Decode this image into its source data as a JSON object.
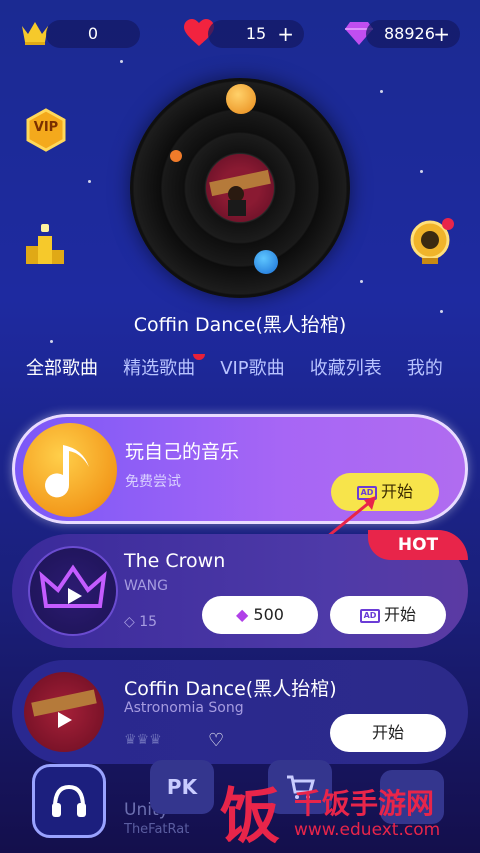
{
  "currency": {
    "crowns": "0",
    "hearts": "15",
    "diamonds": "88926",
    "plus": "+"
  },
  "vip_badge": "VIP",
  "now_playing": {
    "title": "Coffin Dance(黑人抬棺)"
  },
  "tabs": [
    {
      "label": "全部歌曲",
      "active": true
    },
    {
      "label": "精选歌曲",
      "badge": true
    },
    {
      "label": "VIP歌曲"
    },
    {
      "label": "收藏列表"
    },
    {
      "label": "我的"
    }
  ],
  "songs": [
    {
      "title": "玩自己的音乐",
      "subtitle": "免费尝试",
      "button": "开始",
      "button_icon": "AD"
    },
    {
      "title": "The Crown",
      "artist": "WANG",
      "diamonds": "15",
      "price": "500",
      "button": "开始",
      "button_icon": "AD",
      "tag": "HOT"
    },
    {
      "title": "Coffin Dance(黑人抬棺)",
      "artist": "Astronomia Song",
      "button": "开始"
    }
  ],
  "behind": {
    "title": "Unity",
    "artist": "TheFatRat"
  },
  "nav": {
    "pk": "PK"
  },
  "watermark": {
    "char": "饭",
    "name": "千饭手游网",
    "url": "www.eduext.com"
  },
  "colors": {
    "accent": "#f7e44b",
    "hot": "#e8254a",
    "card_main": "#9c62f6"
  }
}
